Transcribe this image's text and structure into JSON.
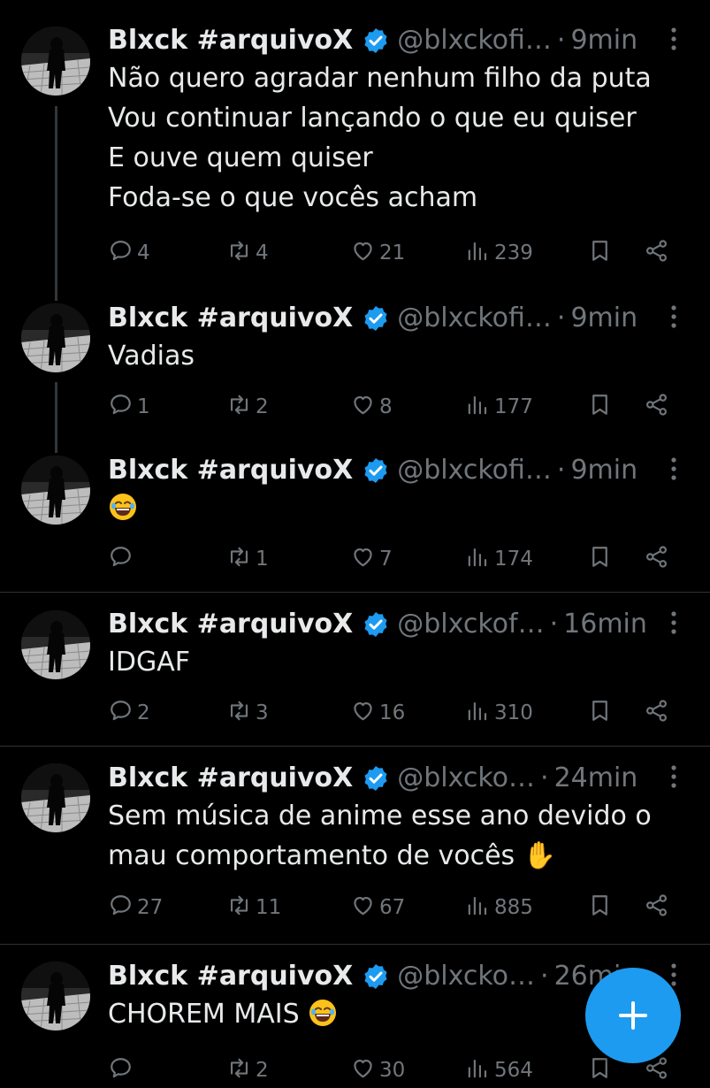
{
  "tweets": [
    {
      "name": "Blxck #arquivoX",
      "handle": "@blxckofi…",
      "time": "9min",
      "text": "Não quero agradar nenhum filho da puta\nVou continuar lançando o que eu quiser\nE ouve quem quiser\nFoda-se o que vocês acham",
      "replies": "4",
      "retweets": "4",
      "likes": "21",
      "views": "239"
    },
    {
      "name": "Blxck #arquivoX",
      "handle": "@blxckofi…",
      "time": "9min",
      "text": "Vadias",
      "replies": "1",
      "retweets": "2",
      "likes": "8",
      "views": "177"
    },
    {
      "name": "Blxck #arquivoX",
      "handle": "@blxckofi…",
      "time": "9min",
      "text": "",
      "replies": "",
      "retweets": "1",
      "likes": "7",
      "views": "174"
    },
    {
      "name": "Blxck #arquivoX",
      "handle": "@blxckof…",
      "time": "16min",
      "text": "IDGAF",
      "replies": "2",
      "retweets": "3",
      "likes": "16",
      "views": "310"
    },
    {
      "name": "Blxck #arquivoX",
      "handle": "@blxcko…",
      "time": "24min",
      "text": "Sem música de anime esse ano devido o\nmau comportamento de vocês ✋",
      "replies": "27",
      "retweets": "11",
      "likes": "67",
      "views": "885"
    },
    {
      "name": "Blxck #arquivoX",
      "handle": "@blxcko…",
      "time": "26min",
      "text": "CHOREM MAIS",
      "replies": "",
      "retweets": "2",
      "likes": "30",
      "views": "564"
    }
  ],
  "dot": "·",
  "colors": {
    "accent": "#1d9bf0",
    "muted": "#71767b",
    "background": "#000000"
  },
  "fab": {
    "icon": "plus-icon"
  }
}
